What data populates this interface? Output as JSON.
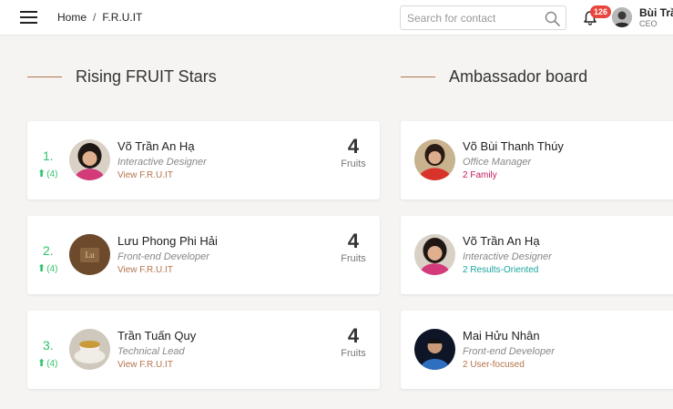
{
  "header": {
    "breadcrumb": {
      "home": "Home",
      "separator": "/",
      "current": "F.R.U.IT"
    },
    "search": {
      "placeholder": "Search for contact",
      "value": ""
    },
    "notifications": {
      "count": "126"
    },
    "user": {
      "name": "Bùi Trầ",
      "role": "CEO"
    }
  },
  "rising": {
    "title": "Rising FRUIT Stars",
    "items": [
      {
        "rank": "1.",
        "delta": "(4)",
        "name": "Võ Trần An Hạ",
        "role": "Interactive Designer",
        "link": "View F.R.U.IT",
        "count": "4",
        "unit": "Fruits"
      },
      {
        "rank": "2.",
        "delta": "(4)",
        "name": "Lưu Phong Phi Hải",
        "role": "Front-end Developer",
        "link": "View F.R.U.IT",
        "count": "4",
        "unit": "Fruits"
      },
      {
        "rank": "3.",
        "delta": "(4)",
        "name": "Trần Tuấn Quy",
        "role": "Technical Lead",
        "link": "View F.R.U.IT",
        "count": "4",
        "unit": "Fruits"
      }
    ]
  },
  "ambassador": {
    "title": "Ambassador board",
    "items": [
      {
        "name": "Võ Bùi Thanh Thúy",
        "role": "Office Manager",
        "tag": "2 Family",
        "tag_color": "#c2185b"
      },
      {
        "name": "Võ Trần An Hạ",
        "role": "Interactive Designer",
        "tag": "2 Results-Oriented",
        "tag_color": "#1aa5a0"
      },
      {
        "name": "Mai Hửu Nhân",
        "role": "Front-end Developer",
        "tag": "2 User-focused",
        "tag_color": "#b4744d"
      }
    ]
  },
  "colors": {
    "accent": "#b4744d",
    "rank_green": "#2fc36a",
    "badge": "#e8463c"
  }
}
